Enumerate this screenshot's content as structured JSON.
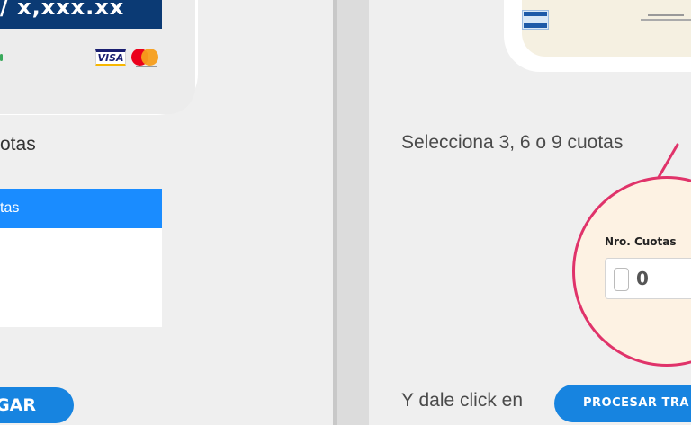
{
  "left": {
    "card_number": "/ x,xxx.xx",
    "visa_label": "VISA",
    "cuotas_text": "otas",
    "dropdown_selected": "tas",
    "button_label": "GAR"
  },
  "right": {
    "instruction": "Selecciona 3, 6 o 9 cuotas",
    "field_label": "Nro. Cuotas",
    "field_value": "0",
    "click_text": "Y dale click en",
    "button_label": "PROCESAR TRA"
  },
  "colors": {
    "primary_blue": "#1784e0",
    "selected_blue": "#1a8cff",
    "card_navy": "#0b3a74",
    "magnifier_border": "#e0336a"
  }
}
